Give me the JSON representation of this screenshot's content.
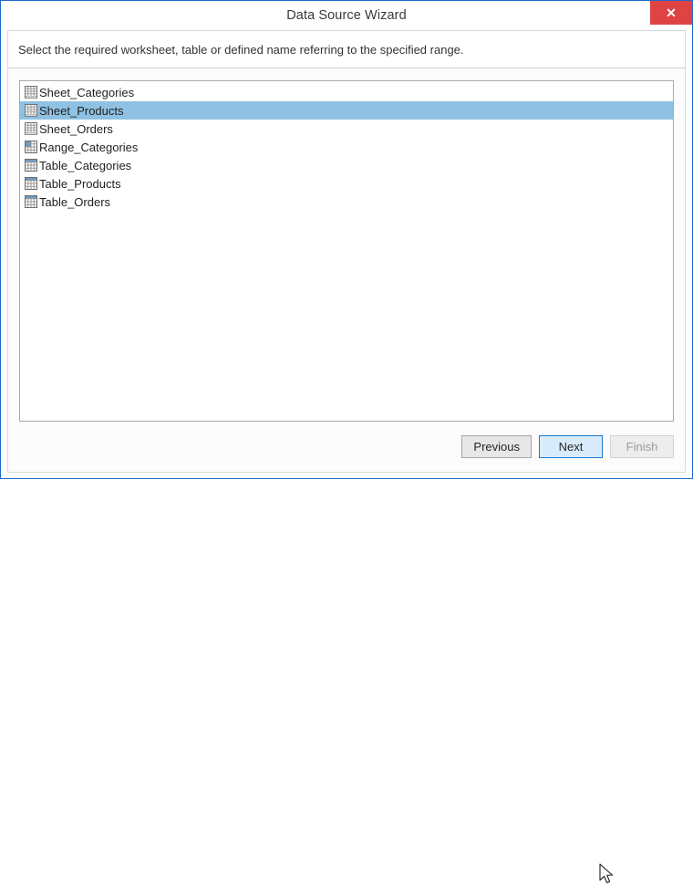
{
  "window": {
    "title": "Data Source Wizard",
    "close_label": "✕"
  },
  "instruction": {
    "text": "Select the required worksheet, table or defined name referring to the specified range."
  },
  "list": {
    "selected_index": 1,
    "items": [
      {
        "label": "Sheet_Categories",
        "icon": "worksheet-icon"
      },
      {
        "label": "Sheet_Products",
        "icon": "worksheet-icon"
      },
      {
        "label": "Sheet_Orders",
        "icon": "worksheet-icon"
      },
      {
        "label": "Range_Categories",
        "icon": "range-icon"
      },
      {
        "label": "Table_Categories",
        "icon": "table-icon"
      },
      {
        "label": "Table_Products",
        "icon": "table-icon"
      },
      {
        "label": "Table_Orders",
        "icon": "table-icon"
      }
    ]
  },
  "footer": {
    "buttons": [
      {
        "label": "Previous",
        "state": "normal"
      },
      {
        "label": "Next",
        "state": "hovered"
      },
      {
        "label": "Finish",
        "state": "disabled"
      }
    ]
  },
  "colors": {
    "window_border": "#1b6ac9",
    "close_red": "#e04343",
    "selection_blue": "#8fc1e3",
    "accent_blue": "#1b7ad1",
    "icon_blue": "#5b9bd5"
  }
}
